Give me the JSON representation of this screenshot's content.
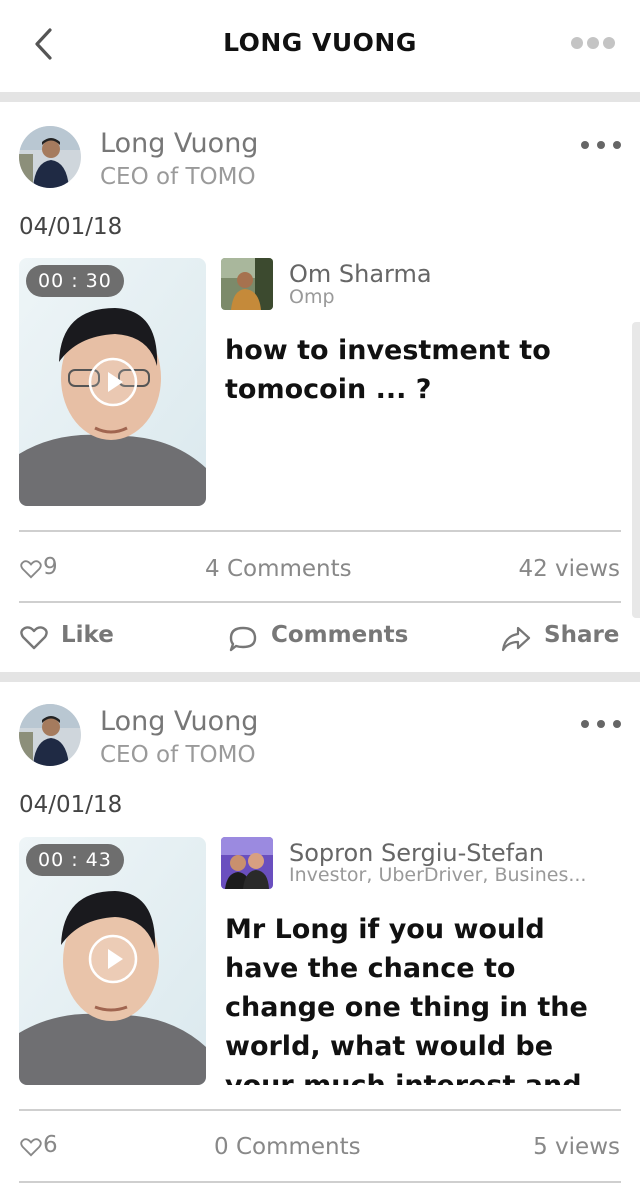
{
  "header": {
    "title": "LONG VUONG",
    "back_icon": "chevron-left-icon",
    "more_icon": "more-horizontal-icon"
  },
  "posts": [
    {
      "author": "Long Vuong",
      "role": "CEO of TOMO",
      "date": "04/01/18",
      "duration": "00 : 30",
      "asker": {
        "name": "Om Sharma",
        "subtitle": "Omp"
      },
      "question": "how to investment to tomocoin ... ?",
      "likes": "9",
      "comments": "4 Comments",
      "views": "42 views"
    },
    {
      "author": "Long Vuong",
      "role": "CEO of TOMO",
      "date": "04/01/18",
      "duration": "00 : 43",
      "asker": {
        "name": "Sopron Sergiu-Stefan",
        "subtitle": "Investor, UberDriver, Busines..."
      },
      "question": "Mr Long if you would have the chance to change one thing in the world, what would be your much interest and approach to",
      "likes": "6",
      "comments": "0 Comments",
      "views": "5 views"
    }
  ],
  "actions": {
    "like": "Like",
    "comments": "Comments",
    "share": "Share"
  },
  "colors": {
    "separator": "#e4e4e4",
    "text_muted": "#888888",
    "duration_badge": "#6e6e6e"
  }
}
